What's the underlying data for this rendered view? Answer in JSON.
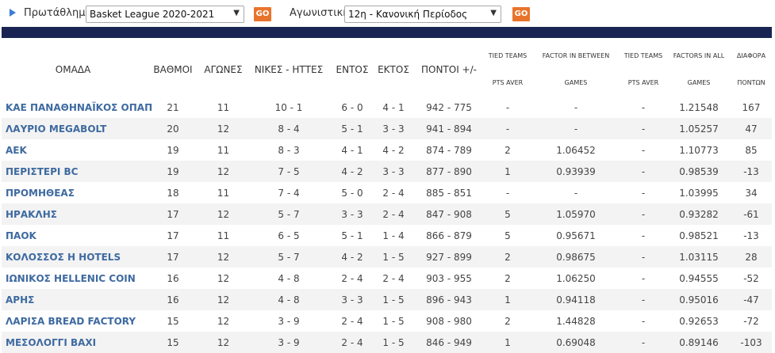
{
  "filters": {
    "league_label": "Πρωτάθλημα",
    "league_value": "Basket League 2020-2021",
    "round_label": "Αγωνιστική",
    "round_value": "12η - Κανονική Περίοδος",
    "go_label": "GO"
  },
  "colors": {
    "band": "#1a2452",
    "team": "#3e6aa0",
    "go": "#e8742c"
  },
  "table": {
    "headers": [
      {
        "l1": "ΟΜΑΔΑ"
      },
      {
        "l1": "ΒΑΘΜΟΙ"
      },
      {
        "l1": "ΑΓΩΝΕΣ"
      },
      {
        "l1": "ΝΙΚΕΣ - ΗΤΤΕΣ"
      },
      {
        "l1": "ΕΝΤΟΣ"
      },
      {
        "l1": "ΕΚΤΟΣ"
      },
      {
        "l1": "ΠΟΝΤΟΙ +/-"
      },
      {
        "l1": "TIED TEAMS",
        "l2": "PTS AVER"
      },
      {
        "l1": "FACTOR IN BETWEEN",
        "l2": "GAMES"
      },
      {
        "l1": "TIED TEAMS",
        "l2": "PTS AVER"
      },
      {
        "l1": "FACTORS IN ALL",
        "l2": "GAMES"
      },
      {
        "l1": "ΔΙΑΦΟΡΑ",
        "l2": "ΠΟΝΤΩΝ"
      }
    ],
    "rows": [
      [
        "ΚΑΕ ΠΑΝΑΘΗΝΑΪΚΟΣ ΟΠΑΠ",
        "21",
        "11",
        "10 - 1",
        "6 - 0",
        "4 - 1",
        "942 - 775",
        "-",
        "-",
        "-",
        "1.21548",
        "167"
      ],
      [
        "ΛΑΥΡΙΟ MEGABOLT",
        "20",
        "12",
        "8 - 4",
        "5 - 1",
        "3 - 3",
        "941 - 894",
        "-",
        "-",
        "-",
        "1.05257",
        "47"
      ],
      [
        "ΑΕΚ",
        "19",
        "11",
        "8 - 3",
        "4 - 1",
        "4 - 2",
        "874 - 789",
        "2",
        "1.06452",
        "-",
        "1.10773",
        "85"
      ],
      [
        "ΠΕΡΙΣΤΕΡΙ BC",
        "19",
        "12",
        "7 - 5",
        "4 - 2",
        "3 - 3",
        "877 - 890",
        "1",
        "0.93939",
        "-",
        "0.98539",
        "-13"
      ],
      [
        "ΠΡΟΜΗΘΕΑΣ",
        "18",
        "11",
        "7 - 4",
        "5 - 0",
        "2 - 4",
        "885 - 851",
        "-",
        "-",
        "-",
        "1.03995",
        "34"
      ],
      [
        "ΗΡΑΚΛΗΣ",
        "17",
        "12",
        "5 - 7",
        "3 - 3",
        "2 - 4",
        "847 - 908",
        "5",
        "1.05970",
        "-",
        "0.93282",
        "-61"
      ],
      [
        "ΠΑΟΚ",
        "17",
        "11",
        "6 - 5",
        "5 - 1",
        "1 - 4",
        "866 - 879",
        "5",
        "0.95671",
        "-",
        "0.98521",
        "-13"
      ],
      [
        "ΚΟΛΟΣΣΟΣ Η HOTELS",
        "17",
        "12",
        "5 - 7",
        "4 - 2",
        "1 - 5",
        "927 - 899",
        "2",
        "0.98675",
        "-",
        "1.03115",
        "28"
      ],
      [
        "ΙΩΝΙΚΟΣ HELLENIC COIN",
        "16",
        "12",
        "4 - 8",
        "2 - 4",
        "2 - 4",
        "903 - 955",
        "2",
        "1.06250",
        "-",
        "0.94555",
        "-52"
      ],
      [
        "ΑΡΗΣ",
        "16",
        "12",
        "4 - 8",
        "3 - 3",
        "1 - 5",
        "896 - 943",
        "1",
        "0.94118",
        "-",
        "0.95016",
        "-47"
      ],
      [
        "ΛΑΡΙΣΑ BREAD FACTORY",
        "15",
        "12",
        "3 - 9",
        "2 - 4",
        "1 - 5",
        "908 - 980",
        "2",
        "1.44828",
        "-",
        "0.92653",
        "-72"
      ],
      [
        "ΜΕΣΟΛΟΓΓΙ ΒΑΧΙ",
        "15",
        "12",
        "3 - 9",
        "2 - 4",
        "1 - 5",
        "846 - 949",
        "1",
        "0.69048",
        "-",
        "0.89146",
        "-103"
      ]
    ]
  }
}
